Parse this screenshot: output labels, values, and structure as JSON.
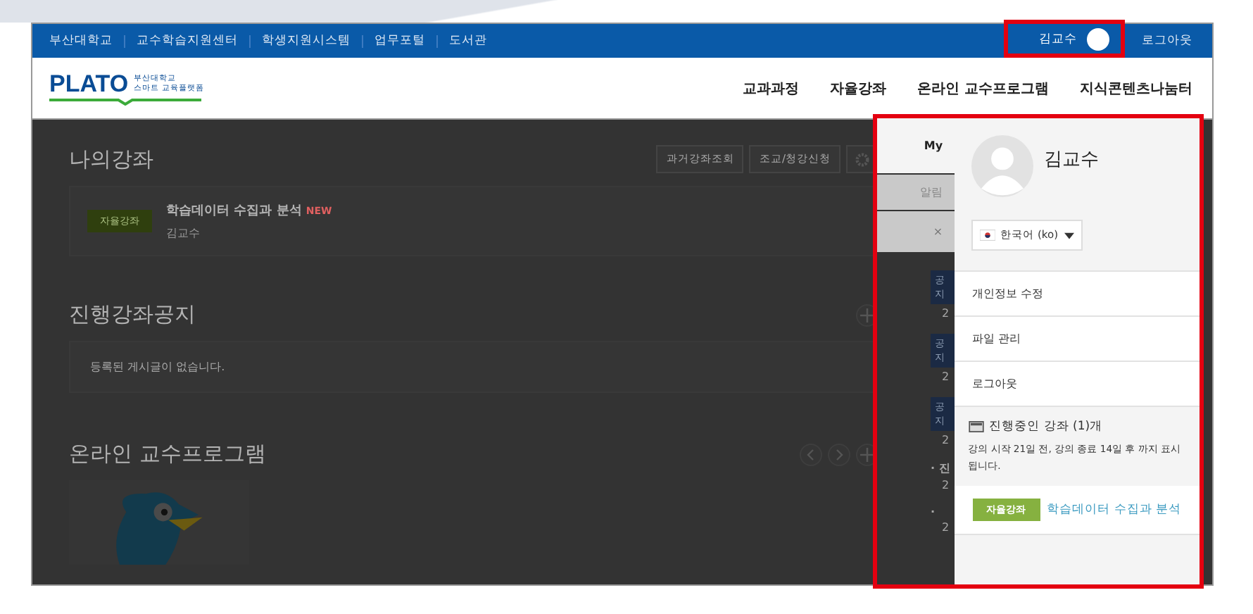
{
  "top_bar": {
    "links": [
      "부산대학교",
      "교수학습지원센터",
      "학생지원시스템",
      "업무포털",
      "도서관"
    ],
    "user_name": "김교수",
    "logout": "로그아웃"
  },
  "header": {
    "logo": {
      "wordmark": "PLATO",
      "subtitle_lines": [
        "부산대학교",
        "스마트 교육플랫폼"
      ]
    },
    "nav": [
      "교과과정",
      "자율강좌",
      "온라인 교수프로그램",
      "지식콘텐츠나눔터"
    ]
  },
  "my_courses": {
    "title": "나의강좌",
    "buttons": [
      "과거강좌조회",
      "조교/청강신청"
    ],
    "courses": [
      {
        "tag": "자율강좌",
        "title": "학습데이터 수집과 분석",
        "badge": "NEW",
        "instructor": "김교수"
      }
    ]
  },
  "notices": {
    "title": "진행강좌공지",
    "empty_message": "등록된 게시글이 없습니다."
  },
  "online_programs": {
    "title": "온라인 교수프로그램"
  },
  "side_notices": [
    {
      "kind": "badge",
      "text": "공지",
      "date": "2"
    },
    {
      "kind": "badge",
      "text": "공지",
      "date": "2"
    },
    {
      "kind": "badge",
      "text": "공지",
      "date": "2"
    },
    {
      "kind": "bullet",
      "text": "· 진",
      "date": "2"
    },
    {
      "kind": "bullet",
      "text": "·",
      "date": "2"
    }
  ],
  "panel": {
    "tabs": [
      {
        "label": "My",
        "selected": true
      },
      {
        "label": "알림",
        "selected": false
      }
    ],
    "close": "×",
    "profile": {
      "name": "김교수",
      "language": "한국어 (ko)"
    },
    "menu": [
      "개인정보 수정",
      "파일 관리",
      "로그아웃"
    ],
    "progress": {
      "heading": "진행중인 강좌 (1)개",
      "note": "강의 시작 21일 전, 강의 종료 14일 후 까지 표시됩니다.",
      "courses": [
        {
          "tag": "자율강좌",
          "title": "학습데이터 수집과 분석"
        }
      ]
    }
  }
}
